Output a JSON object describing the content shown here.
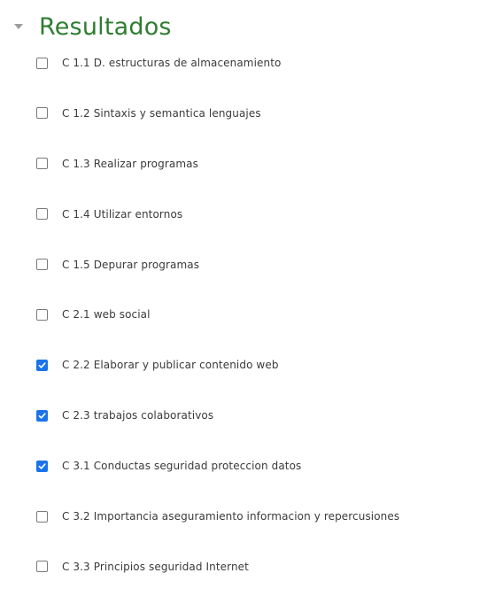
{
  "section": {
    "title": "Resultados",
    "toggle_icon": "caret-down-icon"
  },
  "colors": {
    "title": "#2e7d32",
    "checkbox_checked": "#1a73e8",
    "text": "#3a3a3a"
  },
  "items": [
    {
      "label": "C 1.1 D. estructuras de almacenamiento",
      "checked": false
    },
    {
      "label": "C 1.2 Sintaxis y semantica lenguajes",
      "checked": false
    },
    {
      "label": "C 1.3 Realizar programas",
      "checked": false
    },
    {
      "label": "C 1.4 Utilizar entornos",
      "checked": false
    },
    {
      "label": "C 1.5 Depurar programas",
      "checked": false
    },
    {
      "label": "C 2.1 web social",
      "checked": false
    },
    {
      "label": "C 2.2 Elaborar y publicar contenido web",
      "checked": true
    },
    {
      "label": "C 2.3 trabajos colaborativos",
      "checked": true
    },
    {
      "label": "C 3.1 Conductas seguridad proteccion datos",
      "checked": true
    },
    {
      "label": "C 3.2 Importancia aseguramiento informacion y repercusiones",
      "checked": false
    },
    {
      "label": "C 3.3 Principios seguridad Internet",
      "checked": false
    }
  ]
}
